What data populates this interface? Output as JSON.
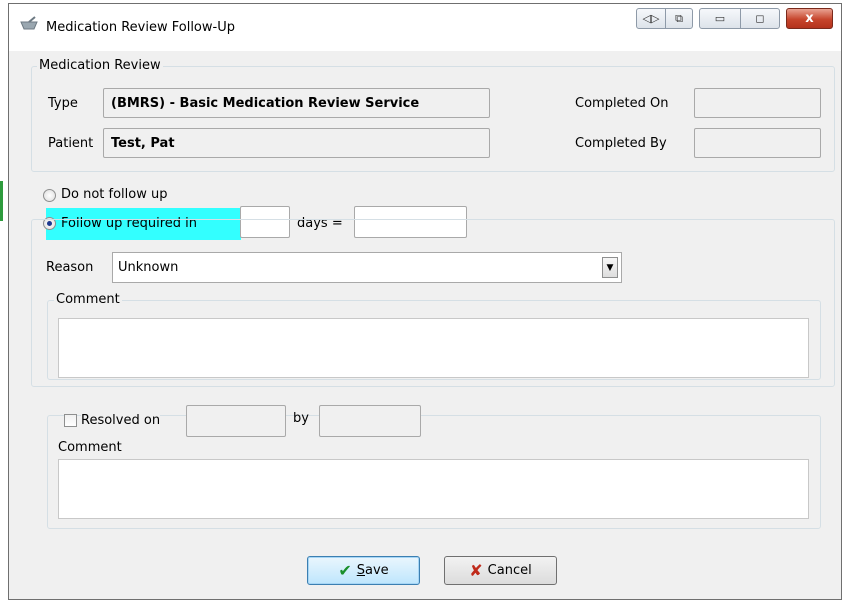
{
  "window": {
    "title": "Medication Review Follow-Up",
    "close_symbol": "x"
  },
  "medication_review": {
    "legend": "Medication Review",
    "type_label": "Type",
    "type_value": "(BMRS) - Basic Medication Review Service",
    "patient_label": "Patient",
    "patient_value": "Test, Pat",
    "completed_on_label": "Completed On",
    "completed_on_value": "",
    "completed_by_label": "Completed By",
    "completed_by_value": ""
  },
  "follow_up": {
    "do_not_follow_up_label": "Do not follow up",
    "follow_up_required_label": "Follow up required in",
    "selected": "follow_up_required",
    "days_value": "",
    "days_label": "days =",
    "date_value": "",
    "reason_label": "Reason",
    "reason_value": "Unknown",
    "comment_legend": "Comment",
    "comment_value": ""
  },
  "resolution": {
    "resolved_on_label": "Resolved on",
    "resolved_checked": false,
    "resolved_on_value": "",
    "by_label": "by",
    "by_value": "",
    "comment_label": "Comment",
    "comment_value": ""
  },
  "buttons": {
    "save_label": "Save",
    "save_mnemonic": "S",
    "save_rest": "ave",
    "cancel_label": "Cancel"
  },
  "colors": {
    "highlight": "#33ffff",
    "save_check": "#1a8f2a",
    "cancel_x": "#c02a1a"
  }
}
